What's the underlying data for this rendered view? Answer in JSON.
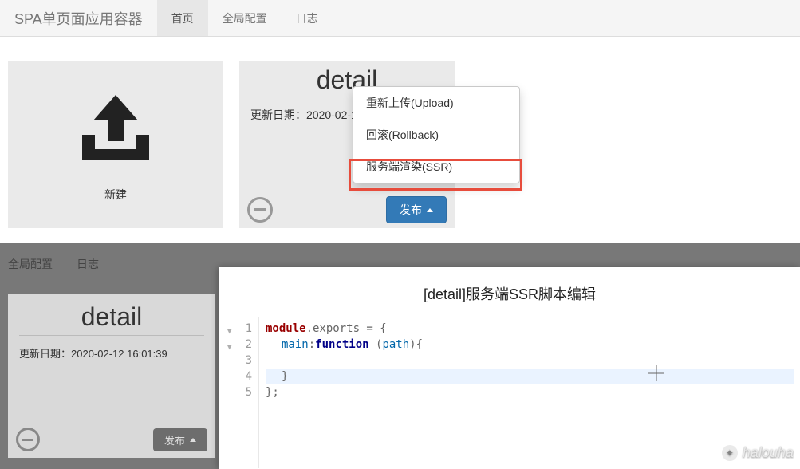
{
  "nav": {
    "brand": "SPA单页面应用容器",
    "items": [
      "首页",
      "全局配置",
      "日志"
    ],
    "active_index": 0
  },
  "upload_card": {
    "label": "新建"
  },
  "detail_card": {
    "title": "detail",
    "date_label": "更新日期：",
    "date_value": "2020-02-12 1",
    "publish_label": "发布"
  },
  "dropdown": {
    "items": [
      "重新上传(Upload)",
      "回滚(Rollback)",
      "服务端渲染(SSR)"
    ]
  },
  "bottom": {
    "tabs": [
      "全局配置",
      "日志"
    ],
    "detail": {
      "title": "detail",
      "date_label": "更新日期：",
      "date_value": "2020-02-12 16:01:39",
      "publish_label": "发布"
    }
  },
  "editor": {
    "title": "[detail]服务端SSR脚本编辑",
    "code": {
      "l1a": "module",
      "l1b": ".exports = {",
      "l2a": "main",
      "l2b": ":",
      "l2c": "function",
      "l2d": " (",
      "l2e": "path",
      "l2f": "){",
      "l3": "",
      "l4": "}",
      "l5": "};"
    },
    "line_numbers": [
      "1",
      "2",
      "3",
      "4",
      "5"
    ]
  },
  "watermark": "halouha"
}
